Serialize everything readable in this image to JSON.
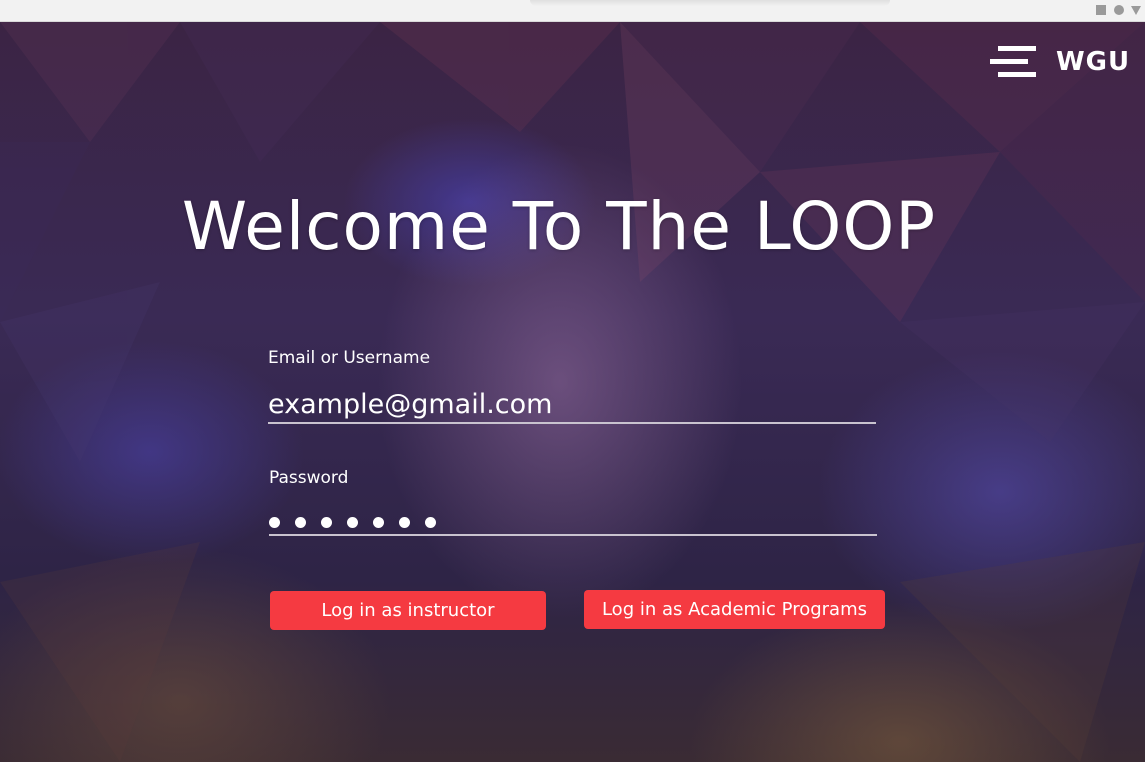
{
  "window": {
    "controls": [
      "square-icon",
      "circle-icon",
      "triangle-down-icon"
    ]
  },
  "brand": {
    "logo_text": "WGU",
    "logo_icon": "wgu-bars-icon"
  },
  "page": {
    "title": "Welcome To The LOOP"
  },
  "login": {
    "email_label": "Email or Username",
    "email_value": "example@gmail.com",
    "password_label": "Password",
    "password_masked_count": 7,
    "buttons": {
      "instructor": "Log in as instructor",
      "academic": "Log in as Academic Programs"
    }
  },
  "colors": {
    "accent": "#f53a41",
    "text": "#ffffff",
    "underline": "#c9c3cf"
  }
}
